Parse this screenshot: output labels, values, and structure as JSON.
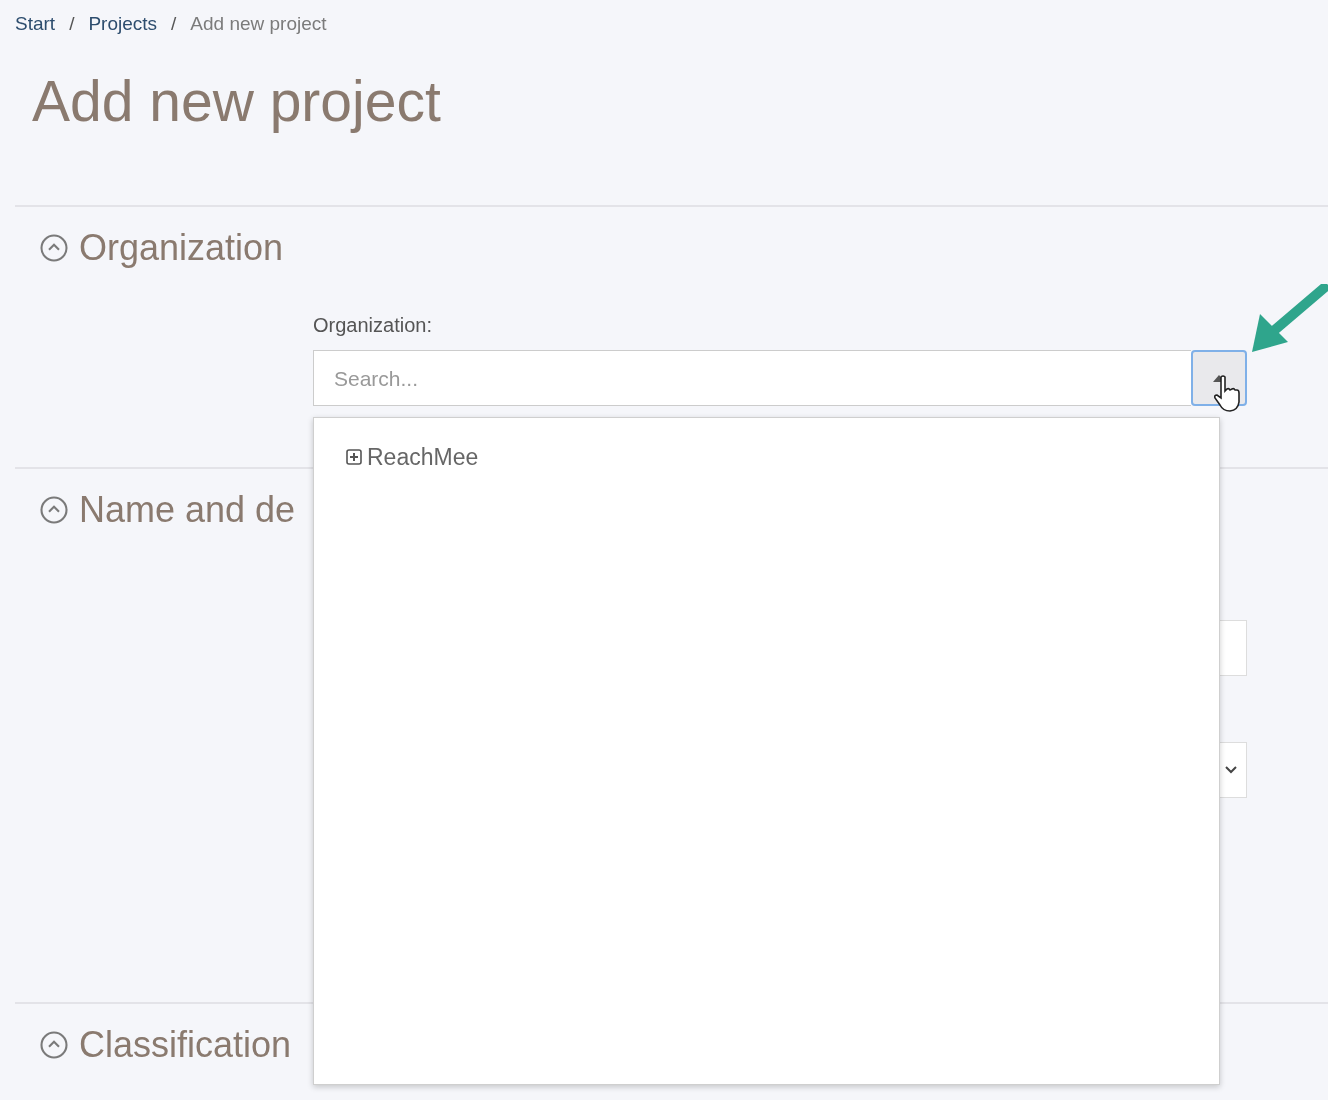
{
  "breadcrumb": [
    {
      "label": "Start",
      "current": false
    },
    {
      "label": "Projects",
      "current": false
    },
    {
      "label": "Add new project",
      "current": true
    }
  ],
  "breadcrumb_separators": [
    "/",
    "/"
  ],
  "title": "Add new project",
  "sections": [
    {
      "heading": "Organization",
      "expanded": true,
      "kind": "organization",
      "field_label": "Organization:",
      "placeholder": "Search...",
      "dropdown": {
        "open": true,
        "items": [
          {
            "label": "ReachMee",
            "expanded": false
          }
        ]
      }
    },
    {
      "heading": "Name and de",
      "expanded": true,
      "kind": "name"
    },
    {
      "heading": "Classification",
      "expanded": true,
      "kind": "classification"
    }
  ]
}
